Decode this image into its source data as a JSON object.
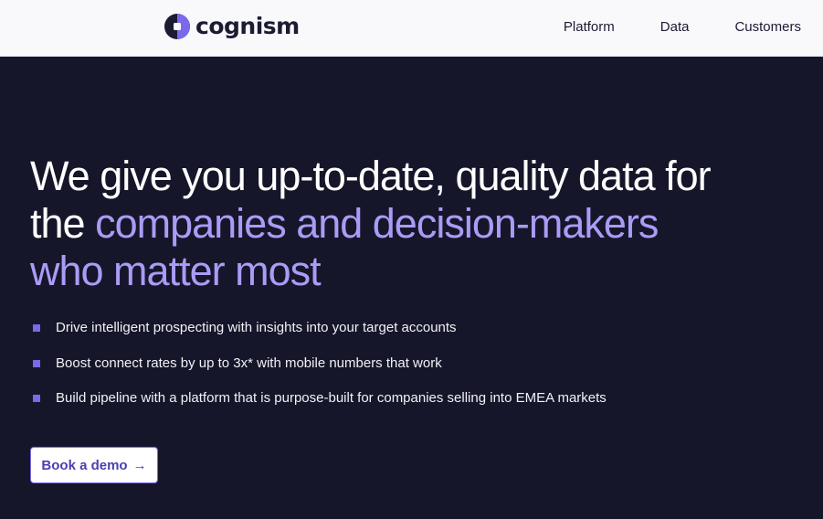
{
  "brand": {
    "name": "cognism",
    "accent": "#a99cf6",
    "dark": "#16162a"
  },
  "nav": {
    "items": [
      {
        "label": "Platform"
      },
      {
        "label": "Data"
      },
      {
        "label": "Customers"
      }
    ]
  },
  "hero": {
    "headline_part1": "We give you up-to-date, quality data for the",
    "headline_accent": "companies and decision-makers who matter most",
    "bullets": [
      {
        "text": "Drive intelligent prospecting with insights into your target accounts"
      },
      {
        "text": "Boost connect rates by up to 3x* with mobile numbers that work"
      },
      {
        "text": "Build pipeline with a platform that is purpose-built for companies selling into EMEA markets"
      }
    ],
    "cta": {
      "label": "Book a demo",
      "icon": "arrow-right-icon"
    }
  }
}
